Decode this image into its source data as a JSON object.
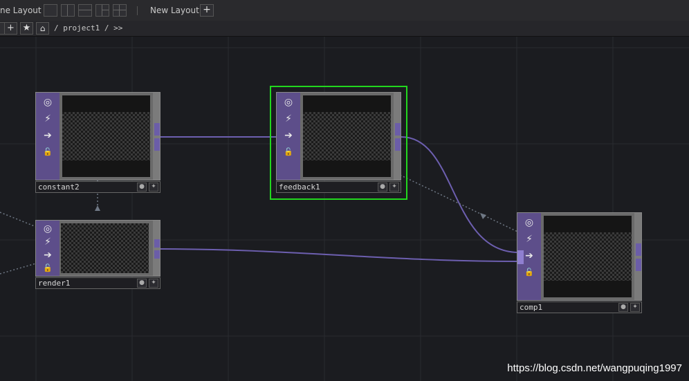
{
  "toolbar": {
    "pane_layout_label": "ne Layout",
    "new_layout_label": "New Layout",
    "add_symbol": "+"
  },
  "pathbar": {
    "path_text": "/ project1 / >>",
    "add_symbol": "+",
    "star_symbol": "★",
    "home_symbol": "⌂"
  },
  "nodes": {
    "constant2": {
      "name": "constant2"
    },
    "render1": {
      "name": "render1"
    },
    "feedback1": {
      "name": "feedback1"
    },
    "comp1": {
      "name": "comp1"
    }
  },
  "icons": {
    "viewer": "◎",
    "cook": "⚡",
    "bypass": "➔",
    "lock": "🔓"
  },
  "colors": {
    "selection": "#22d81e",
    "wire": "#6d5fb0",
    "node_side": "#5d4e8a"
  },
  "watermark": "https://blog.csdn.net/wangpuqing1997"
}
